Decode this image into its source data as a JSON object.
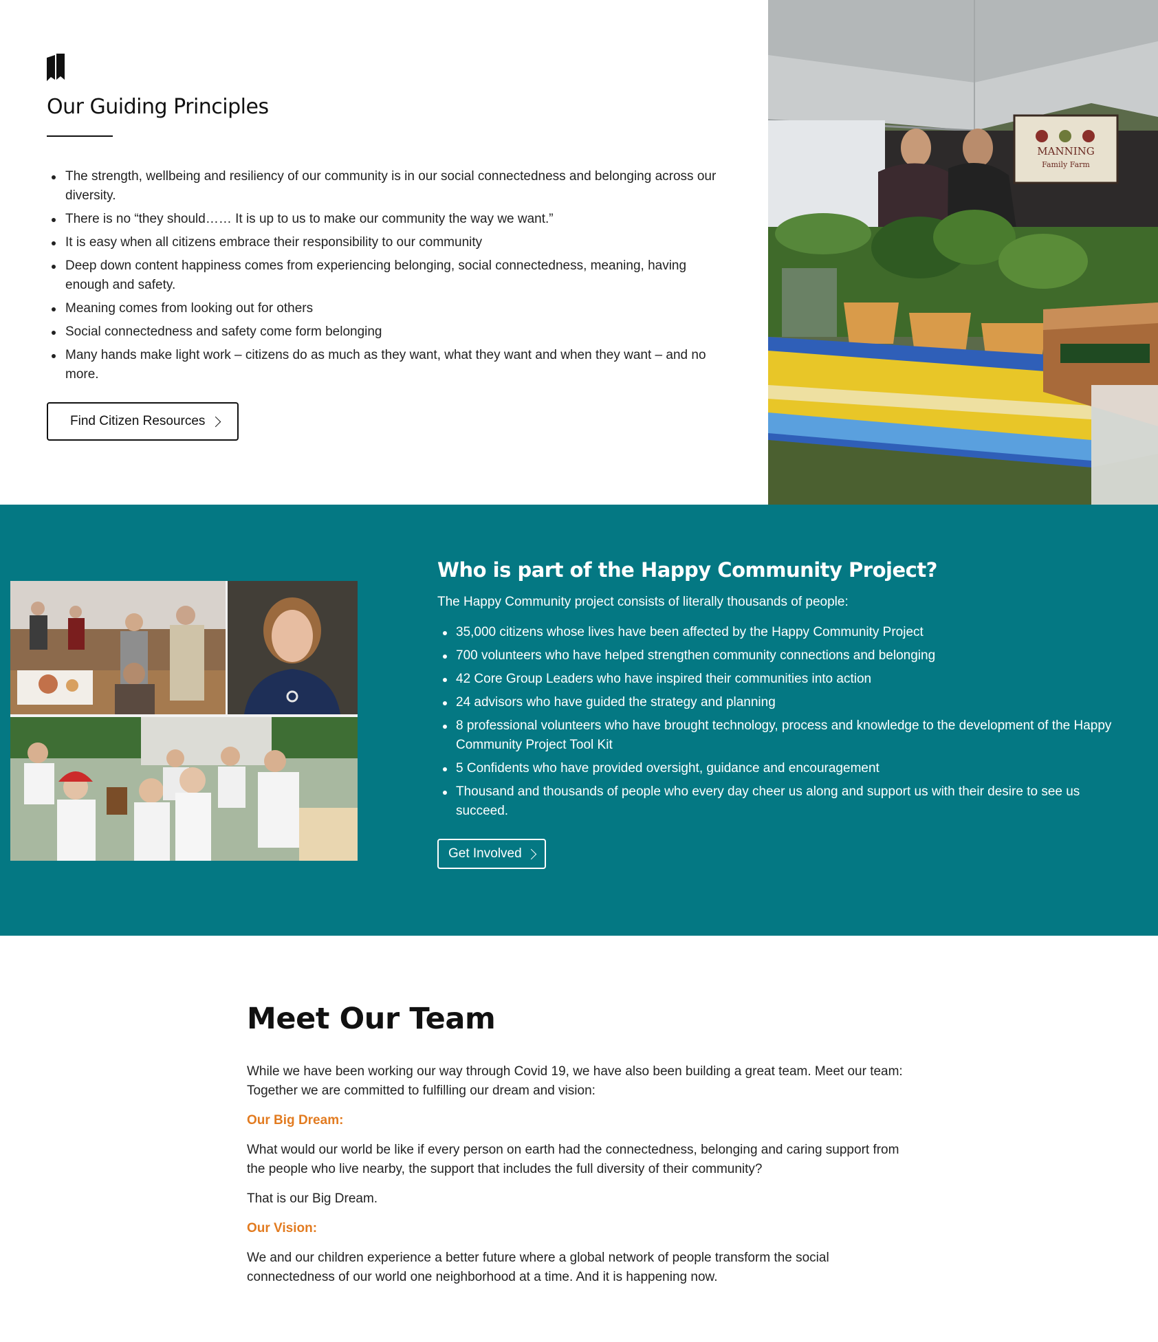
{
  "principles": {
    "icon": "bookmark-icon",
    "title": "Our Guiding Principles",
    "items": [
      "The strength, wellbeing and resiliency of our community is in our social connectedness and belonging across our diversity.",
      "There is no “they should…… It is up to us to make our community the way we want.”",
      "It is easy when all citizens embrace their responsibility to our community",
      "Deep down content happiness comes from experiencing belonging, social connectedness, meaning, having enough and safety.",
      "Meaning comes from looking out for others",
      "Social connectedness and safety come form belonging",
      "Many hands make light work – citizens do as much as they want, what they want and when they want – and no more."
    ],
    "button_label": "Find Citizen Resources",
    "photo_sign_line1": "MANNING",
    "photo_sign_line2": "Family Farm"
  },
  "involved": {
    "title": "Who is part of the Happy Community Project?",
    "intro": "The Happy Community project consists of literally thousands of people:",
    "items": [
      "35,000 citizens whose lives have been affected by the Happy Community Project",
      "700 volunteers who have helped strengthen community connections and belonging",
      "42 Core Group Leaders who have inspired their communities into action",
      "24 advisors who have guided the strategy and planning",
      "8 professional volunteers who have brought technology, process and knowledge to the development of the Happy Community Project Tool Kit",
      "5 Confidents who have provided oversight, guidance and encouragement",
      "Thousand and thousands of people who every day cheer us along and support us with their desire to see us succeed."
    ],
    "button_label": "Get Involved"
  },
  "team": {
    "title": "Meet Our Team",
    "intro": "While we have been working our way through Covid 19, we have also been building a great team. Meet our team: Together we are committed to fulfilling our dream and vision:",
    "dream_heading": "Our Big Dream:",
    "dream_text": "What would our world be like if every person on earth had the connectedness, belonging and caring support from the people who live nearby, the support that includes the full diversity of their community?",
    "dream_closing": "That is our Big Dream.",
    "vision_heading": "Our Vision:",
    "vision_text": "We and our children experience a better future where a global network of people transform the social connectedness of our world one neighborhood at a time. And it is happening now."
  },
  "colors": {
    "teal": "#047883",
    "accent_orange": "#e27b20",
    "text_dark": "#1c1c1c"
  }
}
